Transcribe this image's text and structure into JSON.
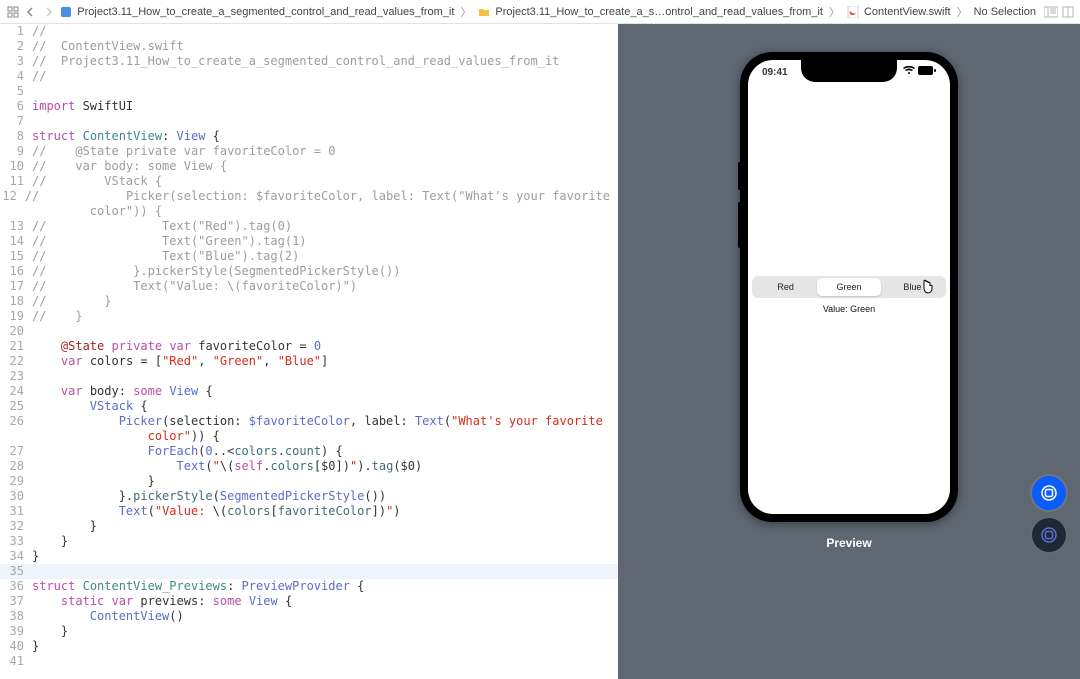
{
  "breadcrumb": {
    "project": "Project3.11_How_to_create_a_segmented_control_and_read_values_from_it",
    "folder": "Project3.11_How_to_create_a_s…ontrol_and_read_values_from_it",
    "file": "ContentView.swift",
    "selection": "No Selection"
  },
  "code_lines": [
    {
      "n": 1,
      "html": "<span class='c-comment'>//</span>"
    },
    {
      "n": 2,
      "html": "<span class='c-comment'>//  ContentView.swift</span>"
    },
    {
      "n": 3,
      "html": "<span class='c-comment'>//  Project3.11_How_to_create_a_segmented_control_and_read_values_from_it</span>"
    },
    {
      "n": 4,
      "html": "<span class='c-comment'>//</span>"
    },
    {
      "n": 5,
      "html": ""
    },
    {
      "n": 6,
      "html": "<span class='c-kw'>import</span> SwiftUI"
    },
    {
      "n": 7,
      "html": ""
    },
    {
      "n": 8,
      "html": "<span class='c-kw'>struct</span> <span class='c-name'>ContentView</span>: <span class='c-type'>View</span> {"
    },
    {
      "n": 9,
      "html": "<span class='c-comment'>//    @State private var favoriteColor = 0</span>"
    },
    {
      "n": 10,
      "html": "<span class='c-comment'>//    var body: some View {</span>"
    },
    {
      "n": 11,
      "html": "<span class='c-comment'>//        VStack {</span>"
    },
    {
      "n": 12,
      "html": "<span class='c-comment'>//            Picker(selection: $favoriteColor, label: Text(\"What's your favorite</span>\n        <span class='c-comment'>color\")) {</span>"
    },
    {
      "n": 13,
      "html": "<span class='c-comment'>//                Text(\"Red\").tag(0)</span>"
    },
    {
      "n": 14,
      "html": "<span class='c-comment'>//                Text(\"Green\").tag(1)</span>"
    },
    {
      "n": 15,
      "html": "<span class='c-comment'>//                Text(\"Blue\").tag(2)</span>"
    },
    {
      "n": 16,
      "html": "<span class='c-comment'>//            }.pickerStyle(SegmentedPickerStyle())</span>"
    },
    {
      "n": 17,
      "html": "<span class='c-comment'>//            Text(\"Value: \\(favoriteColor)\")</span>"
    },
    {
      "n": 18,
      "html": "<span class='c-comment'>//        }</span>"
    },
    {
      "n": 19,
      "html": "<span class='c-comment'>//    }</span>"
    },
    {
      "n": 20,
      "html": ""
    },
    {
      "n": 21,
      "html": "    <span class='c-wrap'>@State</span> <span class='c-kw'>private</span> <span class='c-kw'>var</span> favoriteColor = <span class='c-num'>0</span>"
    },
    {
      "n": 22,
      "html": "    <span class='c-kw'>var</span> colors = [<span class='c-str'>\"Red\"</span>, <span class='c-str'>\"Green\"</span>, <span class='c-str'>\"Blue\"</span>]"
    },
    {
      "n": 23,
      "html": ""
    },
    {
      "n": 24,
      "html": "    <span class='c-kw'>var</span> body: <span class='c-kw'>some</span> <span class='c-type'>View</span> {"
    },
    {
      "n": 25,
      "html": "        <span class='c-type'>VStack</span> {"
    },
    {
      "n": 26,
      "html": "            <span class='c-type'>Picker</span>(selection: <span class='c-type'>$favoriteColor</span>, label: <span class='c-type'>Text</span>(<span class='c-str'>\"What's your favorite</span>\n                <span class='c-str'>color\"</span>)) {"
    },
    {
      "n": 27,
      "html": "                <span class='c-type'>ForEach</span>(<span class='c-num'>0</span>..&lt;<span class='c-prop'>colors</span>.<span class='c-prop'>count</span>) {"
    },
    {
      "n": 28,
      "html": "                    <span class='c-type'>Text</span>(<span class='c-str'>\"</span>\\(<span class='c-kw'>self</span>.<span class='c-prop'>colors</span>[$0])<span class='c-str'>\"</span>).<span class='c-func'>tag</span>($0)"
    },
    {
      "n": 29,
      "html": "                }"
    },
    {
      "n": 30,
      "html": "            }.<span class='c-func'>pickerStyle</span>(<span class='c-type'>SegmentedPickerStyle</span>())"
    },
    {
      "n": 31,
      "html": "            <span class='c-type'>Text</span>(<span class='c-str'>\"Value: </span>\\(<span class='c-prop'>colors</span>[<span class='c-prop'>favoriteColor</span>])<span class='c-str'>\"</span>)"
    },
    {
      "n": 32,
      "html": "        }"
    },
    {
      "n": 33,
      "html": "    }"
    },
    {
      "n": 34,
      "html": "}"
    },
    {
      "n": 35,
      "html": "",
      "hl": true
    },
    {
      "n": 36,
      "html": "<span class='c-kw'>struct</span> <span class='c-name'>ContentView_Previews</span>: <span class='c-type'>PreviewProvider</span> {"
    },
    {
      "n": 37,
      "html": "    <span class='c-kw'>static</span> <span class='c-kw'>var</span> previews: <span class='c-kw'>some</span> <span class='c-type'>View</span> {"
    },
    {
      "n": 38,
      "html": "        <span class='c-type'>ContentView</span>()"
    },
    {
      "n": 39,
      "html": "    }"
    },
    {
      "n": 40,
      "html": "}"
    },
    {
      "n": 41,
      "html": ""
    }
  ],
  "preview": {
    "time": "09:41",
    "segments": [
      "Red",
      "Green",
      "Blue"
    ],
    "selected_index": 1,
    "value_text": "Value: Green",
    "label": "Preview"
  }
}
